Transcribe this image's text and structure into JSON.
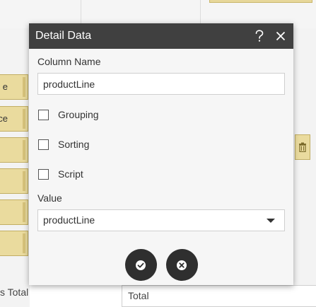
{
  "background": {
    "left_items": [
      "e",
      "ce",
      "",
      "",
      "",
      ""
    ],
    "bottom_label": "s Total",
    "bottom_field_value": "Total",
    "trash_icon": "trash-icon"
  },
  "dialog": {
    "title": "Detail Data",
    "help_icon": "question-mark-icon",
    "close_icon": "close-icon",
    "column_name_label": "Column Name",
    "column_name_value": "productLine",
    "options": [
      {
        "label": "Grouping",
        "checked": false
      },
      {
        "label": "Sorting",
        "checked": false
      },
      {
        "label": "Script",
        "checked": false
      }
    ],
    "value_label": "Value",
    "value_selected": "productLine",
    "ok_icon": "check-icon",
    "cancel_icon": "cancel-icon"
  },
  "colors": {
    "header": "#404040",
    "dialog_bg": "#f6f6f6",
    "item_yellow": "#eadb9e",
    "button_dark": "#2f2f2f"
  }
}
